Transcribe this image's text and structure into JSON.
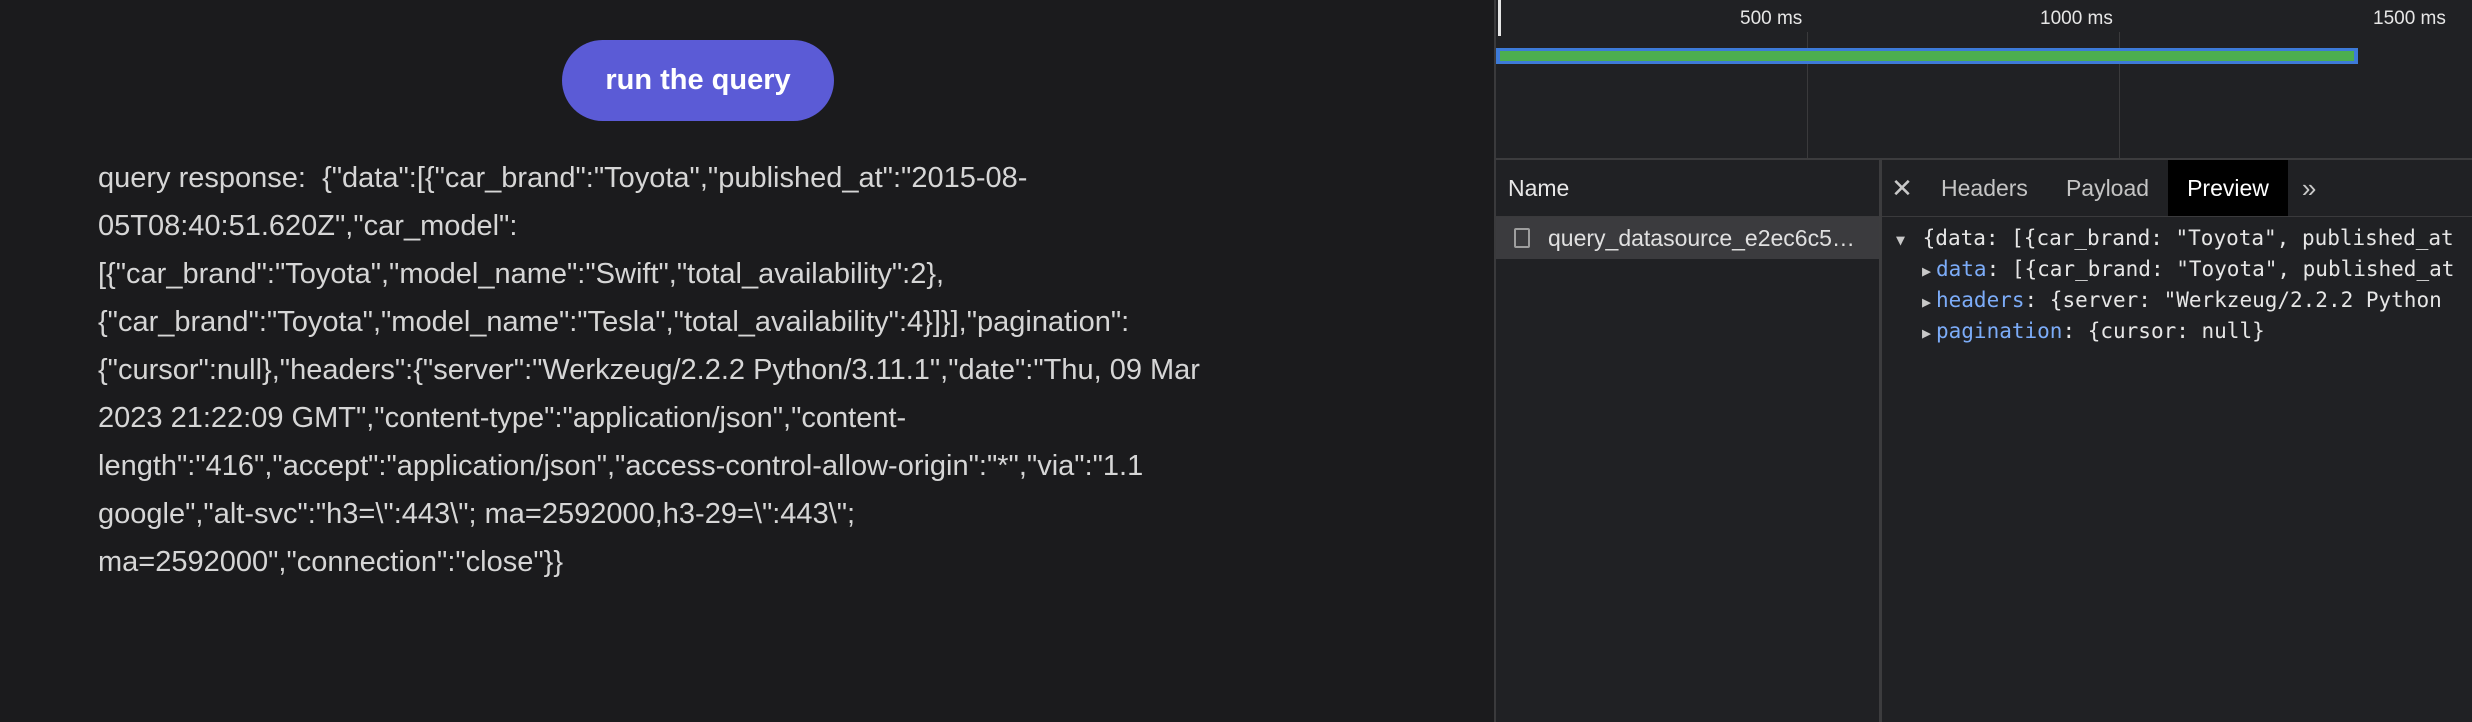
{
  "app": {
    "run_button_label": "run the query",
    "response_lines": [
      "query response:  {\"data\":[{\"car_brand\":\"Toyota\",\"published_at\":\"2015-08-",
      "05T08:40:51.620Z\",\"car_model\":",
      "[{\"car_brand\":\"Toyota\",\"model_name\":\"Swift\",\"total_availability\":2},",
      "{\"car_brand\":\"Toyota\",\"model_name\":\"Tesla\",\"total_availability\":4}]}],\"pagination\":",
      "{\"cursor\":null},\"headers\":{\"server\":\"Werkzeug/2.2.2 Python/3.11.1\",\"date\":\"Thu, 09 Mar",
      "2023 21:22:09 GMT\",\"content-type\":\"application/json\",\"content-",
      "length\":\"416\",\"accept\":\"application/json\",\"access-control-allow-origin\":\"*\",\"via\":\"1.1",
      "google\",\"alt-svc\":\"h3=\\\":443\\\"; ma=2592000,h3-29=\\\":443\\\";",
      "ma=2592000\",\"connection\":\"close\"}}"
    ]
  },
  "devtools": {
    "timeline": {
      "ticks": [
        "500 ms",
        "1000 ms",
        "1500 ms"
      ],
      "request_duration_ms": 1370
    },
    "name_panel": {
      "header": "Name",
      "request_name": "query_datasource_e2ec6c5…"
    },
    "detail": {
      "close_symbol": "✕",
      "tabs": [
        "Headers",
        "Payload",
        "Preview"
      ],
      "active_tab": "Preview",
      "more_symbol": "»",
      "preview": {
        "root_caret": "▼",
        "root": "{data: [{car_brand: \"Toyota\", published_at",
        "child_caret": "▶",
        "rows": [
          {
            "key": "data",
            "value": ": [{car_brand: \"Toyota\", published_at"
          },
          {
            "key": "headers",
            "value": ": {server: \"Werkzeug/2.2.2 Python"
          },
          {
            "key": "pagination",
            "value": ": {cursor: null}"
          }
        ]
      }
    }
  },
  "colors": {
    "button_bg": "#5b5bd6",
    "timeline_outer": "#3d7ad8",
    "timeline_inner": "#4cae4f",
    "json_key": "#7cacf8"
  }
}
